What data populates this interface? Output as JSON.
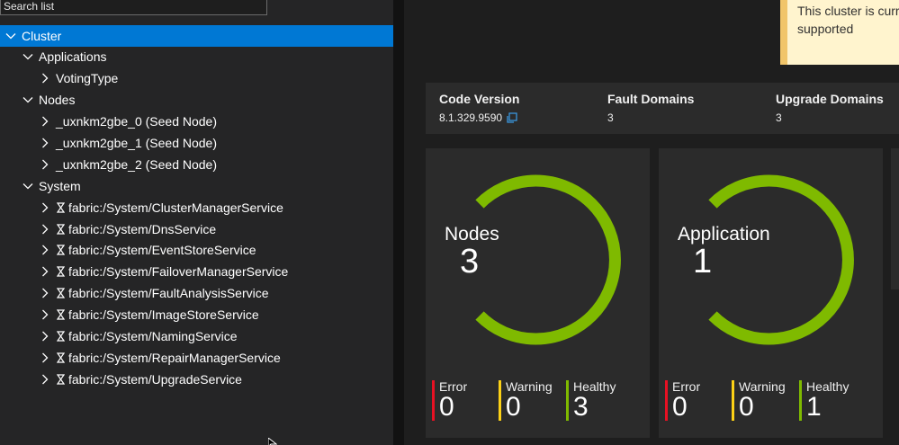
{
  "tree": {
    "search_placeholder": "Search list",
    "items": [
      {
        "label": "Cluster",
        "level": 0,
        "expanded": true,
        "selected": true,
        "service": false
      },
      {
        "label": "Applications",
        "level": 1,
        "expanded": true,
        "selected": false,
        "service": false
      },
      {
        "label": "VotingType",
        "level": 2,
        "expanded": false,
        "selected": false,
        "service": false
      },
      {
        "label": "Nodes",
        "level": 1,
        "expanded": true,
        "selected": false,
        "service": false
      },
      {
        "label": "_uxnkm2gbe_0 (Seed Node)",
        "level": 2,
        "expanded": false,
        "selected": false,
        "service": false
      },
      {
        "label": "_uxnkm2gbe_1 (Seed Node)",
        "level": 2,
        "expanded": false,
        "selected": false,
        "service": false
      },
      {
        "label": "_uxnkm2gbe_2 (Seed Node)",
        "level": 2,
        "expanded": false,
        "selected": false,
        "service": false
      },
      {
        "label": "System",
        "level": 1,
        "expanded": true,
        "selected": false,
        "service": false
      },
      {
        "label": "fabric:/System/ClusterManagerService",
        "level": 2,
        "expanded": false,
        "selected": false,
        "service": true
      },
      {
        "label": "fabric:/System/DnsService",
        "level": 2,
        "expanded": false,
        "selected": false,
        "service": true
      },
      {
        "label": "fabric:/System/EventStoreService",
        "level": 2,
        "expanded": false,
        "selected": false,
        "service": true
      },
      {
        "label": "fabric:/System/FailoverManagerService",
        "level": 2,
        "expanded": false,
        "selected": false,
        "service": true
      },
      {
        "label": "fabric:/System/FaultAnalysisService",
        "level": 2,
        "expanded": false,
        "selected": false,
        "service": true
      },
      {
        "label": "fabric:/System/ImageStoreService",
        "level": 2,
        "expanded": false,
        "selected": false,
        "service": true
      },
      {
        "label": "fabric:/System/NamingService",
        "level": 2,
        "expanded": false,
        "selected": false,
        "service": true
      },
      {
        "label": "fabric:/System/RepairManagerService",
        "level": 2,
        "expanded": false,
        "selected": false,
        "service": true
      },
      {
        "label": "fabric:/System/UpgradeService",
        "level": 2,
        "expanded": false,
        "selected": false,
        "service": true
      }
    ]
  },
  "banner": {
    "line1": "This cluster is curre",
    "line2": "supported"
  },
  "info": {
    "code_version_label": "Code Version",
    "code_version_value": "8.1.329.9590",
    "fault_domains_label": "Fault Domains",
    "fault_domains_value": "3",
    "upgrade_domains_label": "Upgrade Domains",
    "upgrade_domains_value": "3"
  },
  "cards": [
    {
      "title": "Nodes",
      "count": "3",
      "stats": [
        {
          "label": "Error",
          "value": "0",
          "color": "#e81123"
        },
        {
          "label": "Warning",
          "value": "0",
          "color": "#fcd116"
        },
        {
          "label": "Healthy",
          "value": "3",
          "color": "#7fba00"
        }
      ]
    },
    {
      "title": "Application",
      "count": "1",
      "stats": [
        {
          "label": "Error",
          "value": "0",
          "color": "#e81123"
        },
        {
          "label": "Warning",
          "value": "0",
          "color": "#fcd116"
        },
        {
          "label": "Healthy",
          "value": "1",
          "color": "#7fba00"
        }
      ]
    }
  ],
  "colors": {
    "selection": "#0078d4",
    "healthy": "#7fba00",
    "warning": "#fcd116",
    "error": "#e81123",
    "banner_bg": "#fff4ce"
  }
}
